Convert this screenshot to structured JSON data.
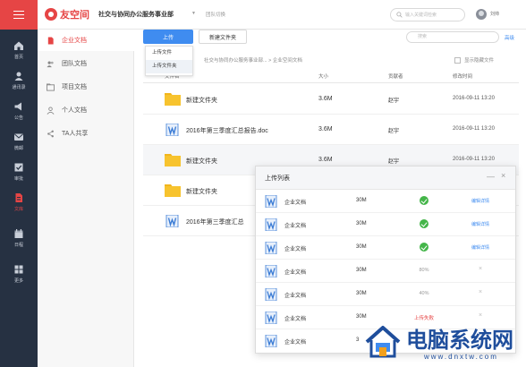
{
  "header": {
    "logo_text": "友空间",
    "org_name": "社交与协同办公服务事业部",
    "switch_label": "团队切换",
    "search_placeholder": "输入关键词检索",
    "user_name": "刘帅"
  },
  "rail": {
    "items": [
      {
        "label": "首页",
        "icon": "home-icon"
      },
      {
        "label": "通讯录",
        "icon": "contacts-icon"
      },
      {
        "label": "公告",
        "icon": "announcement-icon"
      },
      {
        "label": "微邮",
        "icon": "mail-icon"
      },
      {
        "label": "审批",
        "icon": "approval-icon"
      },
      {
        "label": "文库",
        "icon": "document-icon",
        "active": true
      },
      {
        "label": "日程",
        "icon": "calendar-icon"
      },
      {
        "label": "更多",
        "icon": "grid-icon"
      }
    ]
  },
  "left_panel": {
    "items": [
      {
        "label": "企业文档",
        "icon": "document-icon",
        "active": true
      },
      {
        "label": "团队文档",
        "icon": "team-icon"
      },
      {
        "label": "项目文档",
        "icon": "folder-icon"
      },
      {
        "label": "个人文档",
        "icon": "person-icon"
      },
      {
        "label": "TA人共享",
        "icon": "share-icon"
      }
    ]
  },
  "toolbar": {
    "upload_label": "上传",
    "new_folder_label": "新建文件夹",
    "search_placeholder": "搜索",
    "advanced_label": "高级"
  },
  "upload_menu": {
    "items": [
      "上传文件",
      "上传文件夹"
    ]
  },
  "breadcrumb": {
    "path": "社交与协同办公服务事业部...  >  企业空间文档"
  },
  "show_hidden_label": "显示隐藏文件",
  "table": {
    "columns": [
      "文件名",
      "大小",
      "贡献者",
      "修改时间"
    ],
    "rows": [
      {
        "name": "新建文件夹",
        "type": "folder",
        "size": "3.6M",
        "owner": "赵宇",
        "time": "2016-09-11 13:20"
      },
      {
        "name": "2016年第三季度汇总报告.doc",
        "type": "doc",
        "size": "3.6M",
        "owner": "赵宇",
        "time": "2016-09-11 13:20"
      },
      {
        "name": "新建文件夹",
        "type": "folder",
        "size": "3.6M",
        "owner": "赵宇",
        "time": "2016-09-11 13:20"
      },
      {
        "name": "新建文件夹",
        "type": "folder",
        "size": "",
        "owner": "",
        "time": ""
      },
      {
        "name": "2016年第三季度汇总",
        "type": "doc",
        "size": "",
        "owner": "",
        "time": ""
      }
    ]
  },
  "upload_list": {
    "title": "上传列表",
    "rows": [
      {
        "name": "企业文档",
        "size": "30M",
        "status": "done",
        "status_text": "",
        "action": "编辑详情"
      },
      {
        "name": "企业文档",
        "size": "30M",
        "status": "done",
        "status_text": "",
        "action": "编辑详情"
      },
      {
        "name": "企业文档",
        "size": "30M",
        "status": "done",
        "status_text": "",
        "action": "编辑详情"
      },
      {
        "name": "企业文档",
        "size": "30M",
        "status": "progress",
        "status_text": "80%",
        "action": "×"
      },
      {
        "name": "企业文档",
        "size": "30M",
        "status": "progress",
        "status_text": "40%",
        "action": "×"
      },
      {
        "name": "企业文档",
        "size": "30M",
        "status": "failed",
        "status_text": "上传失败",
        "action": "×"
      },
      {
        "name": "企业文档",
        "size": "3",
        "status": "",
        "status_text": "",
        "action": ""
      }
    ]
  },
  "watermark": {
    "title": "电脑系统网",
    "url": "www.dnxtw.com"
  },
  "colors": {
    "brand_red": "#e64545",
    "primary_blue": "#3f8cf0",
    "rail_bg": "#263142",
    "success_green": "#44b549",
    "folder_yellow": "#f7c32e",
    "doc_blue": "#3a7bd5"
  }
}
